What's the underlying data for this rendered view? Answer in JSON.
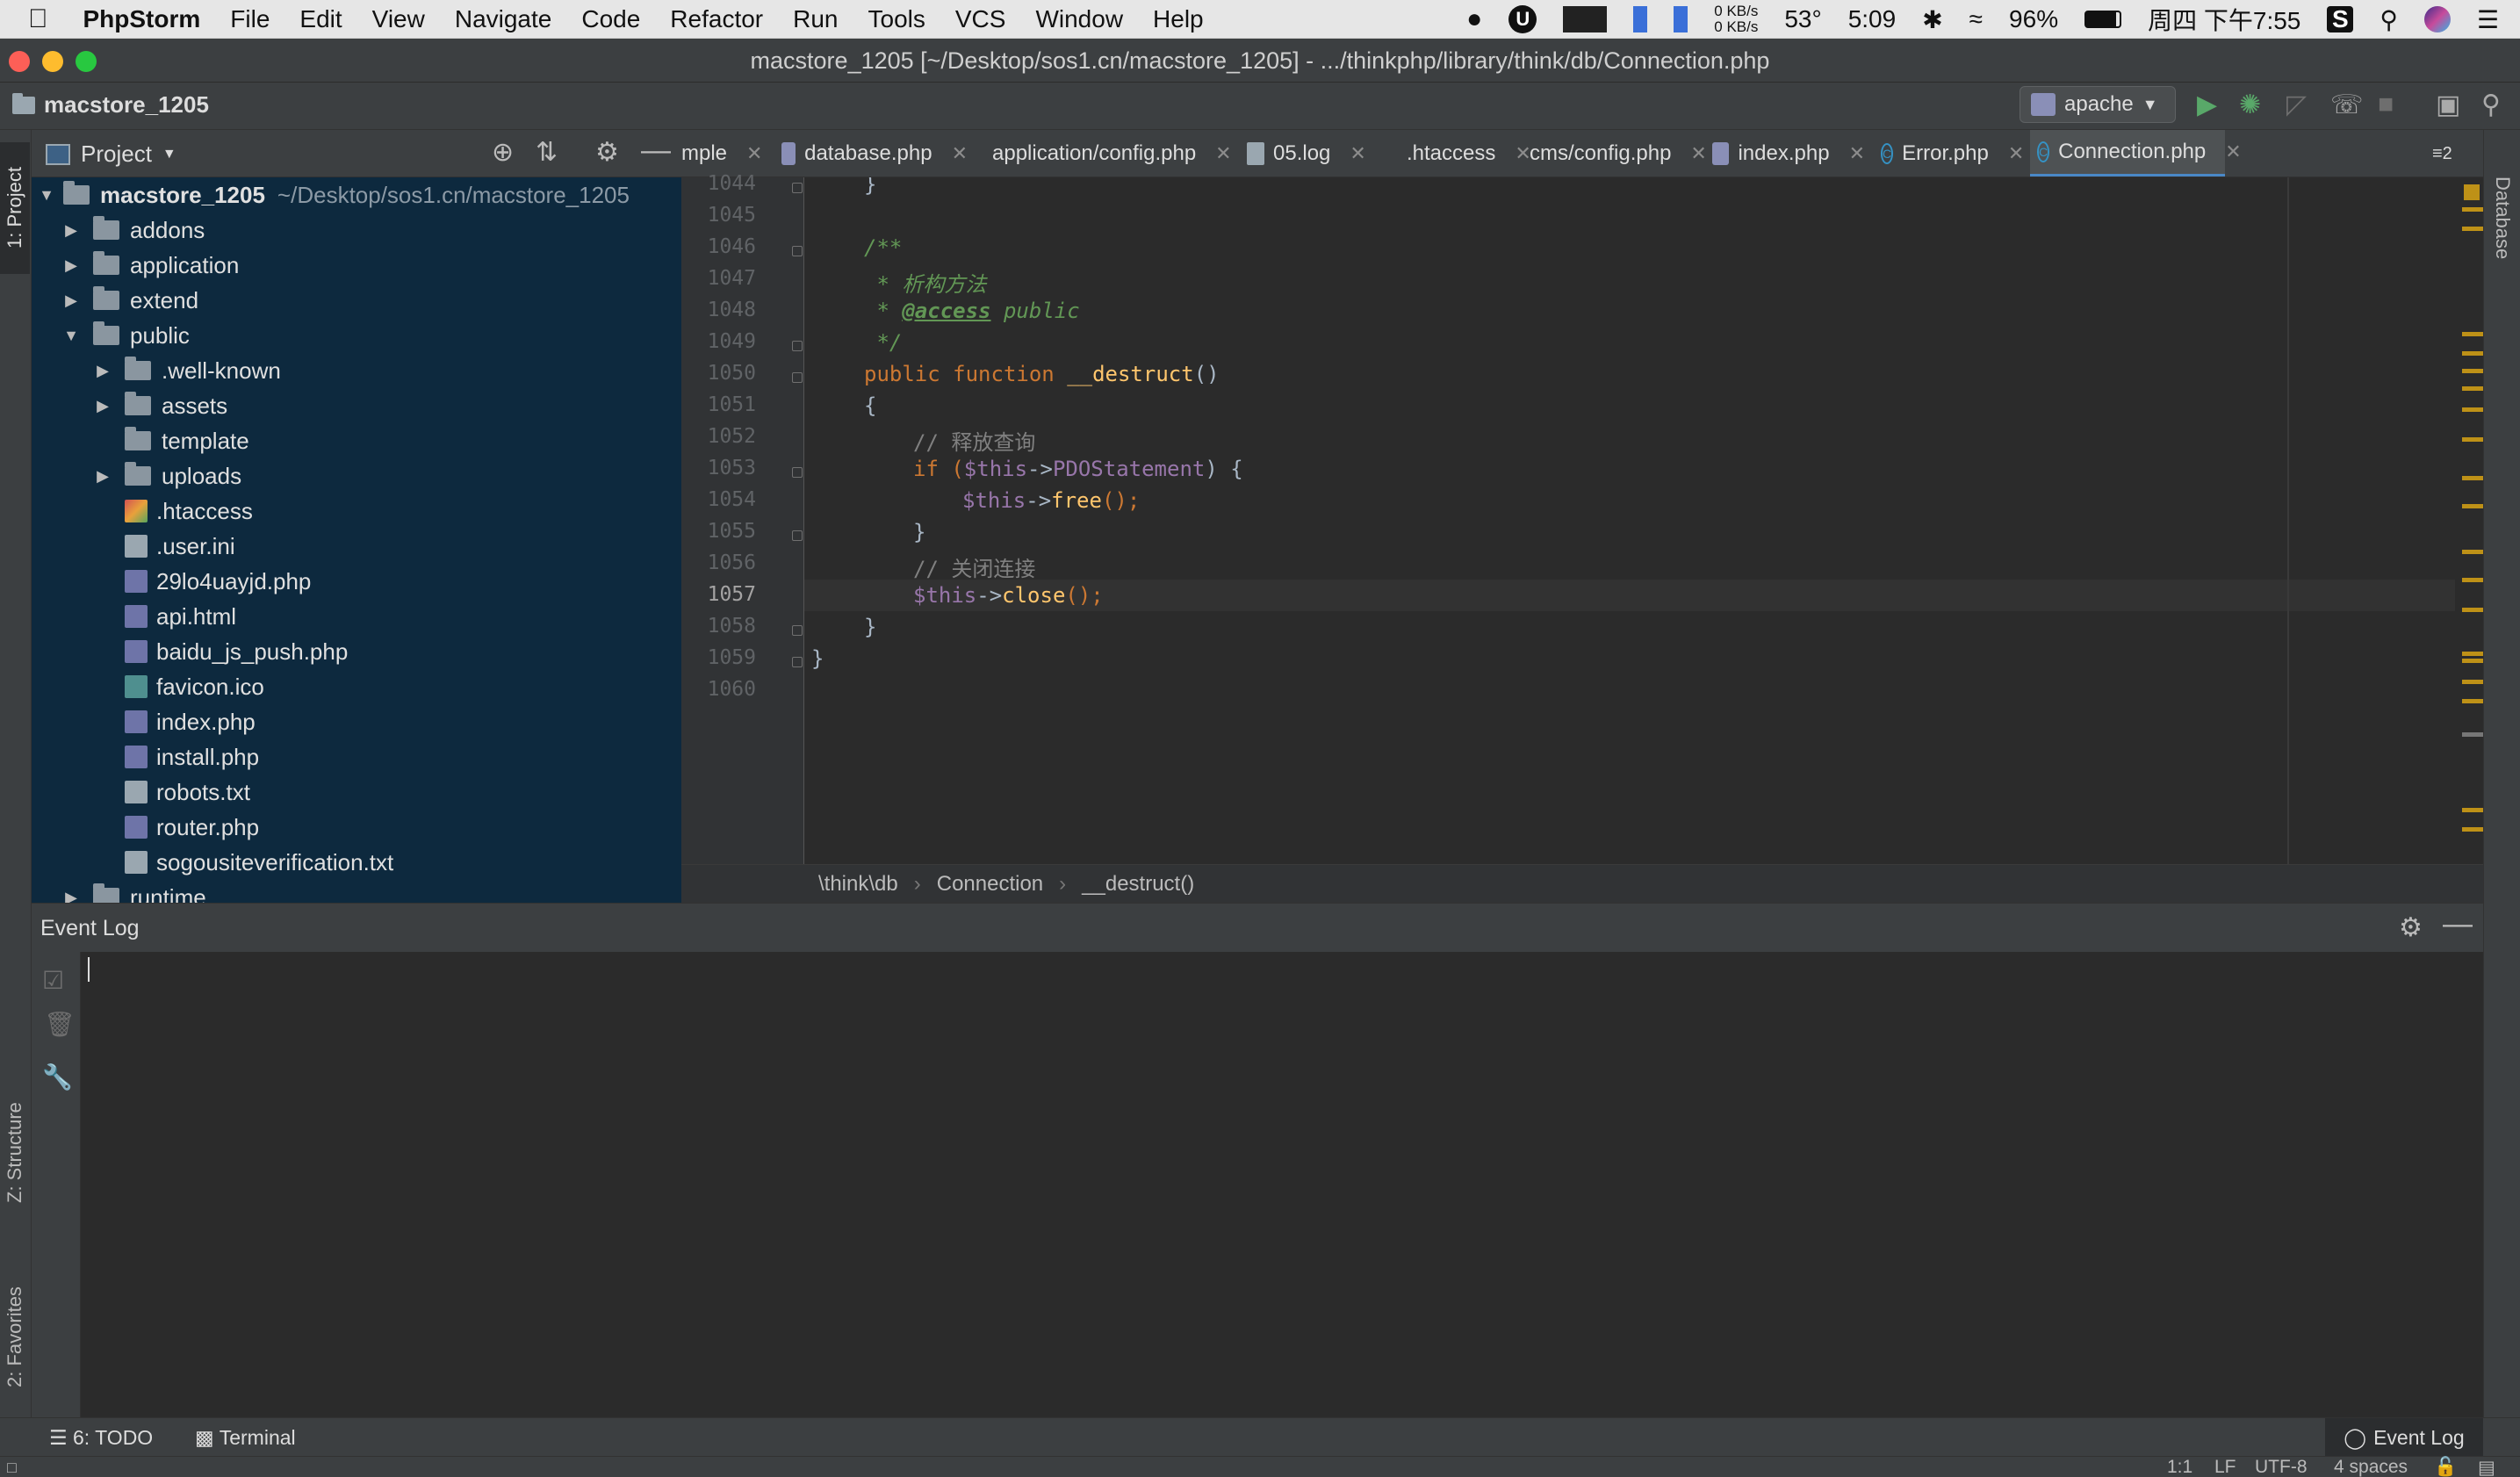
{
  "menubar": {
    "app_name": "PhpStorm",
    "menus": [
      "File",
      "Edit",
      "View",
      "Navigate",
      "Code",
      "Refactor",
      "Run",
      "Tools",
      "VCS",
      "Window",
      "Help"
    ],
    "net_up": "0 KB/s",
    "net_down": "0 KB/s",
    "temperature": "53°",
    "battery_time": "5:09",
    "battery_percent": "96%",
    "clock": "周四 下午7:55"
  },
  "window": {
    "title": "macstore_1205 [~/Desktop/sos1.cn/macstore_1205] - .../thinkphp/library/think/db/Connection.php"
  },
  "navbar": {
    "project_name": "macstore_1205",
    "run_config": "apache"
  },
  "project_panel": {
    "header": "Project",
    "root_name": "macstore_1205",
    "root_path": "~/Desktop/sos1.cn/macstore_1205",
    "items": [
      {
        "label": "addons",
        "type": "folder",
        "level": 1,
        "expanded": false
      },
      {
        "label": "application",
        "type": "folder",
        "level": 1,
        "expanded": false
      },
      {
        "label": "extend",
        "type": "folder",
        "level": 1,
        "expanded": false
      },
      {
        "label": "public",
        "type": "folder",
        "level": 1,
        "expanded": true
      },
      {
        "label": ".well-known",
        "type": "folder",
        "level": 2,
        "expanded": false
      },
      {
        "label": "assets",
        "type": "folder",
        "level": 2,
        "expanded": false
      },
      {
        "label": "template",
        "type": "folder",
        "level": 2,
        "expanded": null
      },
      {
        "label": "uploads",
        "type": "folder",
        "level": 2,
        "expanded": false
      },
      {
        "label": ".htaccess",
        "type": "ht",
        "level": 2
      },
      {
        "label": ".user.ini",
        "type": "txt",
        "level": 2
      },
      {
        "label": "29lo4uayjd.php",
        "type": "php",
        "level": 2
      },
      {
        "label": "api.html",
        "type": "html",
        "level": 2
      },
      {
        "label": "baidu_js_push.php",
        "type": "php",
        "level": 2
      },
      {
        "label": "favicon.ico",
        "type": "ico",
        "level": 2
      },
      {
        "label": "index.php",
        "type": "php",
        "level": 2
      },
      {
        "label": "install.php",
        "type": "php",
        "level": 2
      },
      {
        "label": "robots.txt",
        "type": "txt",
        "level": 2
      },
      {
        "label": "router.php",
        "type": "php",
        "level": 2
      },
      {
        "label": "sogousiteverification.txt",
        "type": "txt",
        "level": 2
      },
      {
        "label": "runtime",
        "type": "folder",
        "level": 1,
        "expanded": false
      }
    ]
  },
  "tabs": [
    {
      "label": "mple",
      "icon": "none"
    },
    {
      "label": "database.php",
      "icon": "php"
    },
    {
      "label": "application/config.php",
      "icon": "php"
    },
    {
      "label": "05.log",
      "icon": "txt"
    },
    {
      "label": ".htaccess",
      "icon": "ht"
    },
    {
      "label": "cms/config.php",
      "icon": "php"
    },
    {
      "label": "index.php",
      "icon": "php"
    },
    {
      "label": "Error.php",
      "icon": "class"
    },
    {
      "label": "Connection.php",
      "icon": "class",
      "active": true
    }
  ],
  "tabs_overflow": "≡2",
  "editor": {
    "line_numbers": [
      "1044",
      "1045",
      "1046",
      "1047",
      "1048",
      "1049",
      "1050",
      "1051",
      "1052",
      "1053",
      "1054",
      "1055",
      "1056",
      "1057",
      "1058",
      "1059",
      "1060"
    ],
    "current_line": "1057",
    "code": {
      "l1044": "}",
      "l1046": "/**",
      "l1047": " * 析构方法",
      "l1048_star": " * ",
      "l1048_tag": "@access",
      "l1048_val": " public",
      "l1049": " */",
      "l1050_kw": "public function ",
      "l1050_fn": "__destruct",
      "l1050_rest": "()",
      "l1051": "{",
      "l1052": "// 释放查询",
      "l1053_if": "if (",
      "l1053_var": "$this",
      "l1053_arrow": "->",
      "l1053_prop": "PDOStatement",
      "l1053_rest": ") {",
      "l1054_var": "$this",
      "l1054_arrow": "->",
      "l1054_fn": "free",
      "l1054_rest": "();",
      "l1055": "}",
      "l1056": "// 关闭连接",
      "l1057_var": "$this",
      "l1057_arrow": "->",
      "l1057_fn": "close",
      "l1057_rest": "();",
      "l1058": "}",
      "l1059": "}"
    }
  },
  "breadcrumb": [
    "\\think\\db",
    "Connection",
    "__destruct()"
  ],
  "right_strip": {
    "database": "Database"
  },
  "left_strip": {
    "project": "1: Project",
    "structure": "Z: Structure",
    "favorites": "2: Favorites"
  },
  "event_log": {
    "title": "Event Log"
  },
  "bottom_bar": {
    "todo": "6: TODO",
    "terminal": "Terminal",
    "event_log": "Event Log"
  },
  "status_bar": {
    "position": "1:1",
    "line_sep": "LF",
    "encoding": "UTF-8",
    "indent": "4 spaces"
  },
  "colors": {
    "tree_bg": "#0d293e",
    "editor_bg": "#2b2b2b",
    "panel_bg": "#3c3f41",
    "accent": "#4a88c7",
    "marker": "#be9117"
  }
}
